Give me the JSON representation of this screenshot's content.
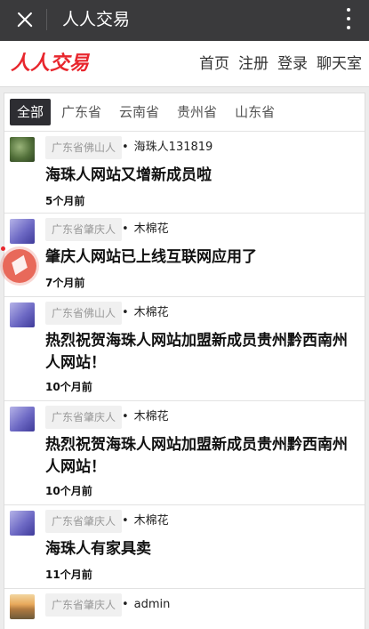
{
  "topbar": {
    "title": "人人交易"
  },
  "header": {
    "logo": "人人交易",
    "nav": [
      "首页",
      "注册",
      "登录",
      "聊天室"
    ]
  },
  "tabs": [
    {
      "label": "全部",
      "active": true
    },
    {
      "label": "广东省",
      "active": false
    },
    {
      "label": "云南省",
      "active": false
    },
    {
      "label": "贵州省",
      "active": false
    },
    {
      "label": "山东省",
      "active": false
    }
  ],
  "posts": [
    {
      "avatar": "green",
      "location": "广东省佛山人",
      "author": "海珠人131819",
      "title": "海珠人网站又增新成员啦",
      "time": "5个月前"
    },
    {
      "avatar": "purple",
      "location": "广东省肇庆人",
      "author": "木棉花",
      "title": "肇庆人网站已上线互联网应用了",
      "time": "7个月前"
    },
    {
      "avatar": "purple",
      "location": "广东省佛山人",
      "author": "木棉花",
      "title": "热烈祝贺海珠人网站加盟新成员贵州黔西南州人网站！",
      "time": "10个月前"
    },
    {
      "avatar": "purple",
      "location": "广东省肇庆人",
      "author": "木棉花",
      "title": "热烈祝贺海珠人网站加盟新成员贵州黔西南州人网站！",
      "time": "10个月前"
    },
    {
      "avatar": "purple",
      "location": "广东省肇庆人",
      "author": "木棉花",
      "title": "海珠人有家具卖",
      "time": "11个月前"
    },
    {
      "avatar": "sunset",
      "location": "广东省肇庆人",
      "author": "admin",
      "title": "",
      "time": ""
    }
  ],
  "colors": {
    "brand": "#e8262d",
    "topbar": "#3a3a3c",
    "tab_active": "#2d2d32"
  }
}
